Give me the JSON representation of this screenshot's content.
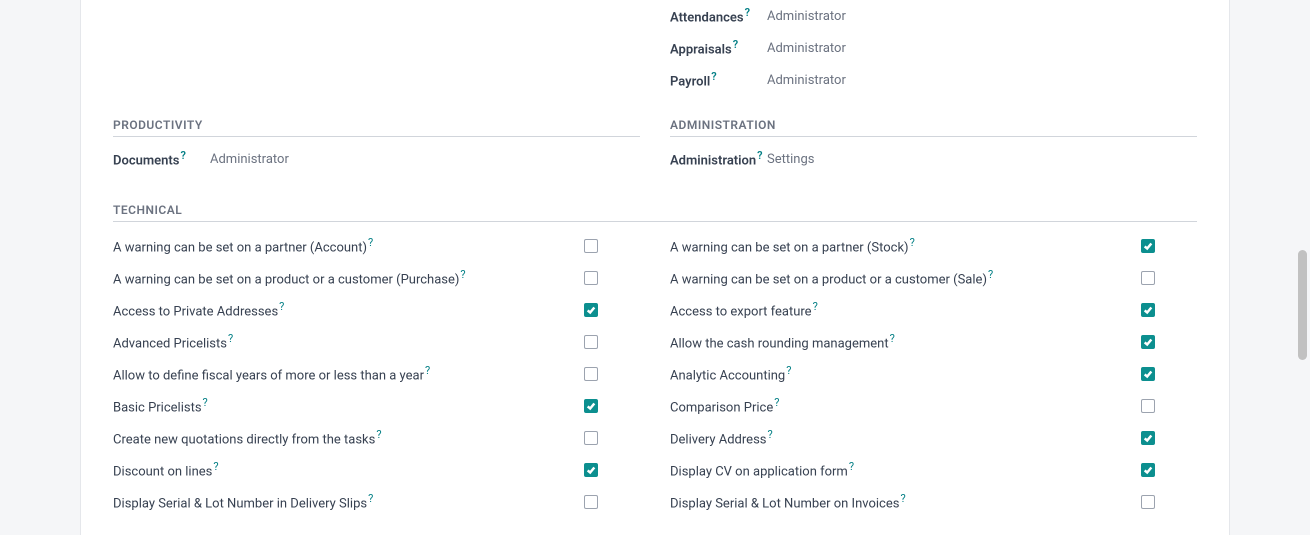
{
  "top_rows": {
    "left": [],
    "right": [
      {
        "label": "Attendances",
        "help": "?",
        "value": "Administrator"
      },
      {
        "label": "Appraisals",
        "help": "?",
        "value": "Administrator"
      },
      {
        "label": "Payroll",
        "help": "?",
        "value": "Administrator"
      }
    ]
  },
  "sections": {
    "productivity": {
      "title": "PRODUCTIVITY",
      "rows": [
        {
          "label": "Documents",
          "help": "?",
          "value": "Administrator"
        }
      ]
    },
    "administration": {
      "title": "ADMINISTRATION",
      "rows": [
        {
          "label": "Administration",
          "help": "?",
          "value": "Settings"
        }
      ]
    }
  },
  "technical": {
    "title": "TECHNICAL",
    "left": [
      {
        "label": "A warning can be set on a partner (Account)",
        "help": "?",
        "checked": false
      },
      {
        "label": "A warning can be set on a product or a customer (Purchase)",
        "help": "?",
        "checked": false
      },
      {
        "label": "Access to Private Addresses",
        "help": "?",
        "checked": true
      },
      {
        "label": "Advanced Pricelists",
        "help": "?",
        "checked": false
      },
      {
        "label": "Allow to define fiscal years of more or less than a year",
        "help": "?",
        "checked": false
      },
      {
        "label": "Basic Pricelists",
        "help": "?",
        "checked": true
      },
      {
        "label": "Create new quotations directly from the tasks",
        "help": "?",
        "checked": false
      },
      {
        "label": "Discount on lines",
        "help": "?",
        "checked": true
      },
      {
        "label": "Display Serial & Lot Number in Delivery Slips",
        "help": "?",
        "checked": false
      }
    ],
    "right": [
      {
        "label": "A warning can be set on a partner (Stock)",
        "help": "?",
        "checked": true
      },
      {
        "label": "A warning can be set on a product or a customer (Sale)",
        "help": "?",
        "checked": false
      },
      {
        "label": "Access to export feature",
        "help": "?",
        "checked": true
      },
      {
        "label": "Allow the cash rounding management",
        "help": "?",
        "checked": true
      },
      {
        "label": "Analytic Accounting",
        "help": "?",
        "checked": true
      },
      {
        "label": "Comparison Price",
        "help": "?",
        "checked": false
      },
      {
        "label": "Delivery Address",
        "help": "?",
        "checked": true
      },
      {
        "label": "Display CV on application form",
        "help": "?",
        "checked": true
      },
      {
        "label": "Display Serial & Lot Number on Invoices",
        "help": "?",
        "checked": false
      }
    ]
  }
}
